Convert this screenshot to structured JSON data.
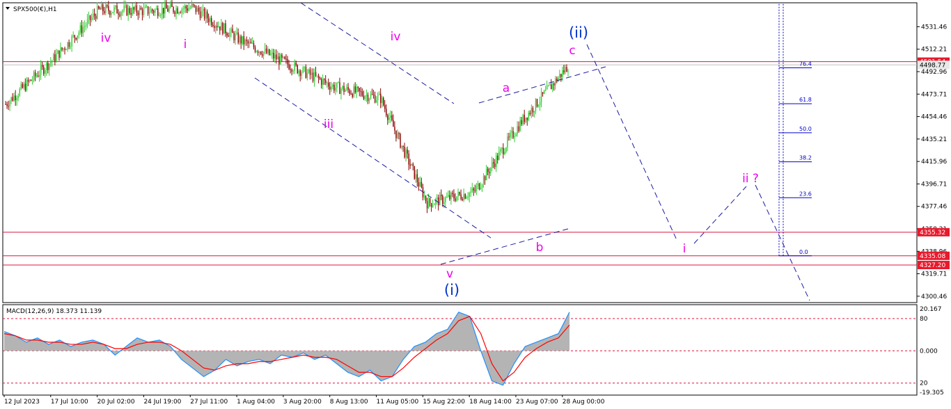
{
  "chart_data": [
    {
      "type": "candlestick",
      "title": "SPX500(€),H1",
      "symbol": "SPX500(€)",
      "timeframe": "H1",
      "ylim": [
        4295,
        4552
      ],
      "y_ticks": [
        "4531.46",
        "4512.21",
        "4492.96",
        "4473.71",
        "4454.46",
        "4435.21",
        "4415.96",
        "4396.71",
        "4377.46",
        "4358.21",
        "4338.96",
        "4319.71",
        "4300.46"
      ],
      "x_ticks": [
        "12 Jul 2023",
        "17 Jul 10:00",
        "20 Jul 02:00",
        "24 Jul 19:00",
        "27 Jul 11:00",
        "1 Aug 04:00",
        "3 Aug 20:00",
        "8 Aug 13:00",
        "11 Aug 05:00",
        "15 Aug 22:00",
        "18 Aug 14:00",
        "23 Aug 07:00",
        "28 Aug 00:00"
      ],
      "current_price": "4498.77",
      "price_levels": [
        "4501.54",
        "4355.32",
        "4335.08",
        "4327.20"
      ],
      "price_path": [
        {
          "label": "12 Jul 2023",
          "price": 4465
        },
        {
          "label": "17 Jul 10:00",
          "price": 4503
        },
        {
          "label": "20 Jul 02:00",
          "price": 4546
        },
        {
          "label": "24 Jul 19:00",
          "price": 4545
        },
        {
          "label": "27 Jul 11:00",
          "price": 4548
        },
        {
          "label": "1 Aug 04:00",
          "price": 4520
        },
        {
          "label": "3 Aug 20:00",
          "price": 4500
        },
        {
          "label": "8 Aug 13:00",
          "price": 4480
        },
        {
          "label": "11 Aug 05:00",
          "price": 4470
        },
        {
          "label": "15 Aug 22:00",
          "price": 4380
        },
        {
          "label": "18 Aug 14:00",
          "price": 4390
        },
        {
          "label": "23 Aug 07:00",
          "price": 4450
        },
        {
          "label": "28 Aug 00:00",
          "price": 4498
        }
      ],
      "wave_labels": [
        "iv",
        "i",
        "iii",
        "iv",
        "v",
        "(i)",
        "a",
        "b",
        "c",
        "(ii)",
        "i",
        "ii ?"
      ],
      "fibonacci": [
        "0.0",
        "23.6",
        "38.2",
        "50.0",
        "61.8",
        "76.4"
      ],
      "colors": {
        "bull": "#32cd32",
        "bear": "#8b0000",
        "level_line": "#dc143c",
        "level_label_bg": "#e8192c",
        "current_label_bg": "#e8e8e8",
        "trendline": "#1a1aa0",
        "wave_minor": "#ee00ee",
        "wave_major": "#0033cc",
        "fib": "#0000cd"
      }
    },
    {
      "type": "line",
      "title": "MACD(12,26,9) 18.373 11.139",
      "ylim": [
        -19.305,
        20.167
      ],
      "y_ticks": [
        "20.167",
        "0.000",
        "-19.305"
      ],
      "levels": [
        {
          "label": "80",
          "value": 15
        },
        {
          "label": "20",
          "value": -15
        }
      ],
      "x_ticks": [
        "12 Jul 2023",
        "17 Jul 10:00",
        "20 Jul 02:00",
        "24 Jul 19:00",
        "27 Jul 11:00",
        "1 Aug 04:00",
        "3 Aug 20:00",
        "8 Aug 13:00",
        "11 Aug 05:00",
        "15 Aug 22:00",
        "18 Aug 14:00",
        "23 Aug 07:00",
        "28 Aug 00:00"
      ],
      "series": [
        {
          "name": "MACD",
          "values": [
            9,
            7,
            4,
            6,
            3,
            5,
            2,
            4,
            5,
            3,
            -2,
            2,
            6,
            4,
            5,
            2,
            -4,
            -8,
            -12,
            -9,
            -4,
            -7,
            -5,
            -4,
            -6,
            -2,
            -3,
            -1,
            -4,
            -2,
            -6,
            -10,
            -12,
            -9,
            -14,
            -12,
            -4,
            2,
            4,
            8,
            10,
            18,
            16,
            0,
            -14,
            -16,
            -6,
            2,
            4,
            6,
            8,
            18
          ]
        },
        {
          "name": "Signal",
          "values": [
            8,
            7,
            5,
            5,
            4,
            4,
            3,
            3,
            4,
            3,
            1,
            1,
            3,
            4,
            4,
            3,
            0,
            -4,
            -8,
            -9,
            -7,
            -6,
            -6,
            -5,
            -5,
            -4,
            -3,
            -2,
            -3,
            -3,
            -4,
            -7,
            -10,
            -10,
            -12,
            -12,
            -8,
            -3,
            1,
            5,
            8,
            14,
            16,
            8,
            -6,
            -14,
            -10,
            -3,
            1,
            4,
            6,
            12
          ]
        }
      ]
    }
  ]
}
